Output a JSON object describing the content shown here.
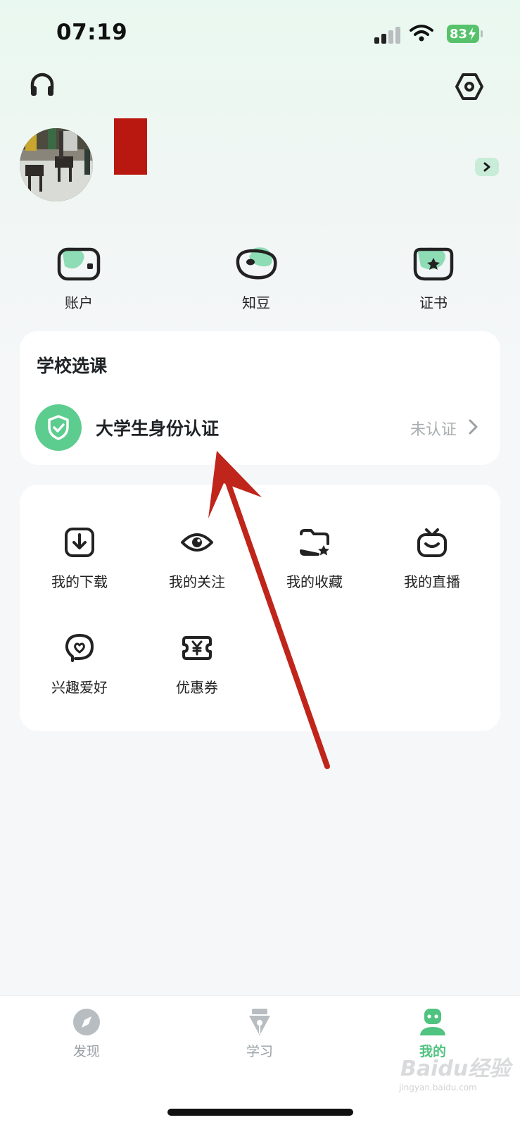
{
  "status_bar": {
    "time": "07:19",
    "battery": "83"
  },
  "header": {
    "left_icon": "headset-icon",
    "right_icon": "settings-hexagon-icon"
  },
  "profile": {
    "avatar_icon": "avatar-photo",
    "more_icon": "chevron-right-icon"
  },
  "quick_actions": [
    {
      "label": "账户",
      "icon": "wallet-icon"
    },
    {
      "label": "知豆",
      "icon": "bean-icon"
    },
    {
      "label": "证书",
      "icon": "certificate-icon"
    }
  ],
  "school_card": {
    "title": "学校选课",
    "verify_label": "大学生身份认证",
    "verify_status": "未认证",
    "verify_icon": "shield-check-icon"
  },
  "services": [
    {
      "label": "我的下载",
      "icon": "download-icon"
    },
    {
      "label": "我的关注",
      "icon": "eye-icon"
    },
    {
      "label": "我的收藏",
      "icon": "folder-star-icon"
    },
    {
      "label": "我的直播",
      "icon": "tv-icon"
    },
    {
      "label": "兴趣爱好",
      "icon": "interest-heart-icon"
    },
    {
      "label": "优惠券",
      "icon": "coupon-icon"
    }
  ],
  "tabs": [
    {
      "label": "发现",
      "icon": "compass-icon",
      "active": false
    },
    {
      "label": "学习",
      "icon": "pen-nib-icon",
      "active": false
    },
    {
      "label": "我的",
      "icon": "robot-user-icon",
      "active": true
    }
  ],
  "watermark": {
    "brand": "Baidu经验",
    "url": "jingyan.baidu.com"
  },
  "colors": {
    "accent": "#4fc37f",
    "annotation": "#c0251b"
  }
}
